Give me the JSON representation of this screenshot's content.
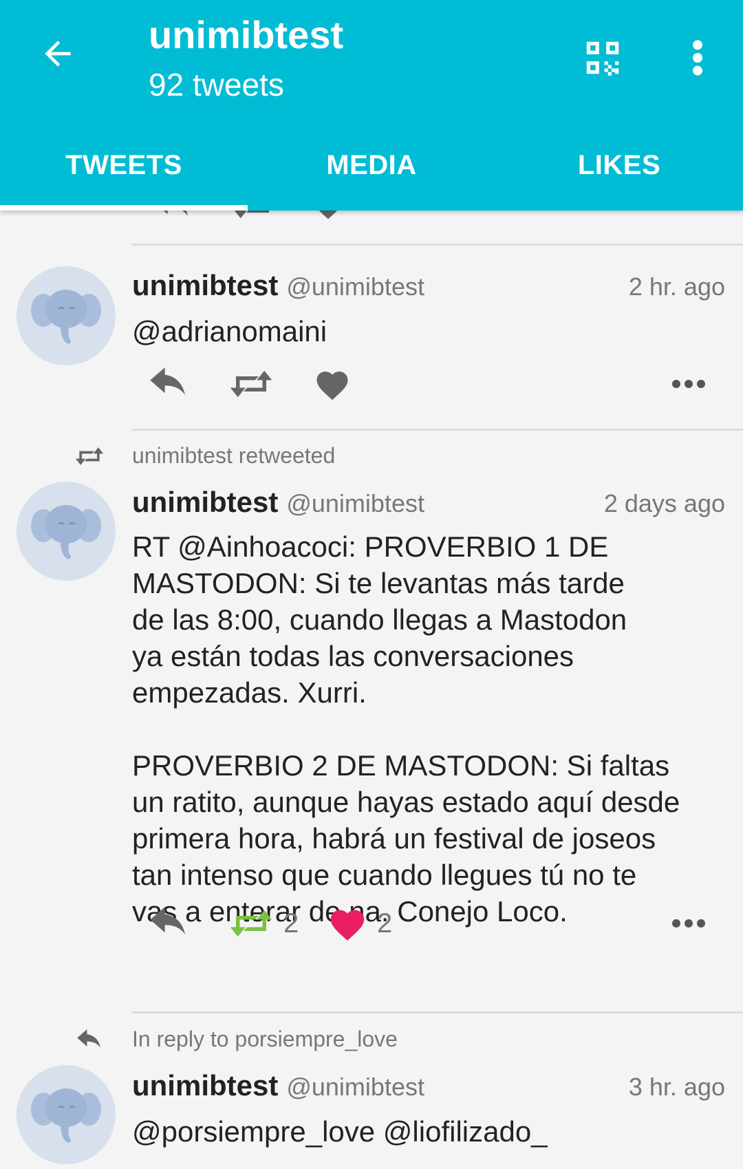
{
  "header": {
    "title": "unimibtest",
    "subtitle": "92 tweets",
    "back_icon": "arrow-left-icon",
    "qr_icon": "qr-code-icon",
    "overflow_icon": "more-vertical-icon",
    "background_color": "#00bcd4"
  },
  "tabs": [
    {
      "label": "TWEETS",
      "selected": true
    },
    {
      "label": "MEDIA",
      "selected": false
    },
    {
      "label": "LIKES",
      "selected": false
    }
  ],
  "tweets": [
    {
      "status_line": "",
      "name": "unimibtest",
      "handle": "@unimibtest",
      "time": "2 hr. ago",
      "content": "@adrianomaini",
      "retweets": "",
      "likes": "",
      "retweeted_by_me": false,
      "liked_by_me": false
    },
    {
      "status_line": "unimibtest retweeted",
      "name": "unimibtest",
      "handle": "@unimibtest",
      "time": "2 days ago",
      "content": "RT @Ainhoacoci: PROVERBIO 1 DE\nMASTODON: Si te levantas más tarde\nde las 8:00, cuando llegas a Mastodon\nya están todas las conversaciones\nempezadas. Xurri.\n\nPROVERBIO 2 DE MASTODON: Si faltas\nun ratito, aunque hayas estado aquí desde\nprimera hora, habrá un festival de joseos\ntan intenso que cuando llegues tú no te\nvas a enterar de na. Conejo Loco.",
      "retweets": "2",
      "likes": "2",
      "retweeted_by_me": true,
      "liked_by_me": true
    },
    {
      "status_line": "In reply to porsiempre_love",
      "name": "unimibtest",
      "handle": "@unimibtest",
      "time": "3 hr. ago",
      "content": "@porsiempre_love @liofilizado_",
      "retweets": "",
      "likes": "",
      "retweeted_by_me": false,
      "liked_by_me": false
    }
  ],
  "colors": {
    "accent": "#00bcd4",
    "retweet_active": "#7cc142",
    "like_active": "#e91e63",
    "action_inactive": "#666666"
  }
}
